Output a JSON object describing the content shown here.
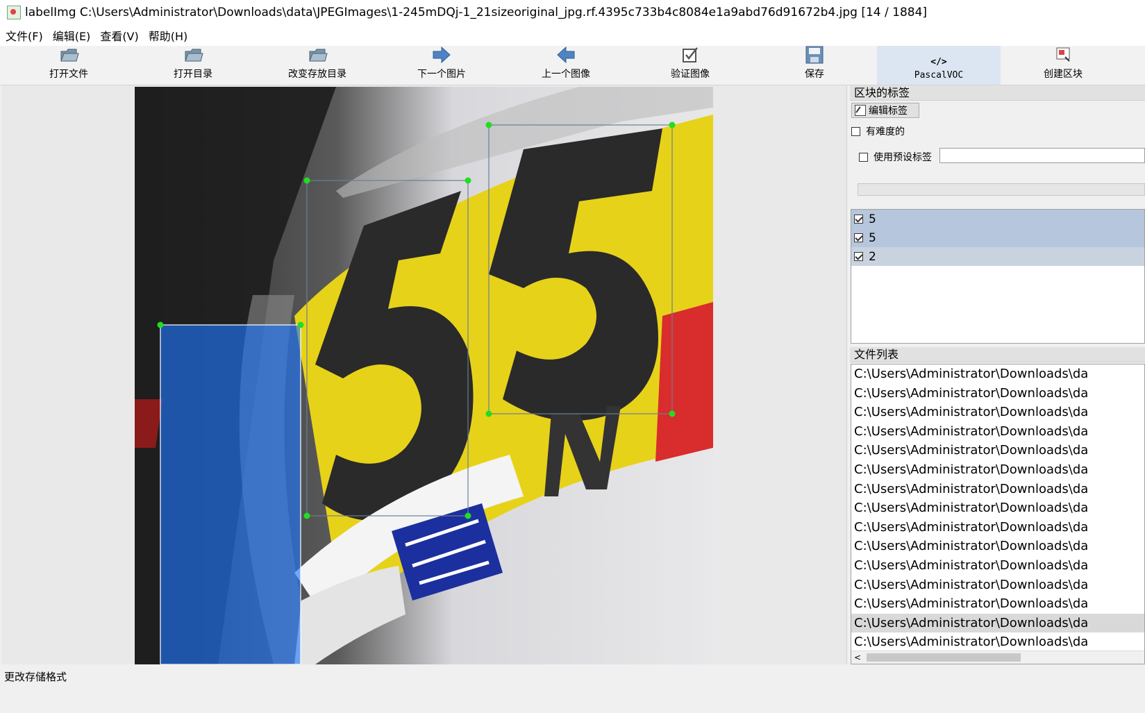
{
  "window": {
    "title": "labelImg C:\\Users\\Administrator\\Downloads\\data\\JPEGImages\\1-245mDQj-1_21sizeoriginal_jpg.rf.4395c733b4c8084e1a9abd76d91672b4.jpg [14 / 1884]"
  },
  "menu": [
    "文件(F)",
    "编辑(E)",
    "查看(V)",
    "帮助(H)"
  ],
  "toolbar": {
    "open_file": "打开文件",
    "open_dir": "打开目录",
    "change_save_dir": "改变存放目录",
    "next_image": "下一个图片",
    "prev_image": "上一个图像",
    "verify_image": "验证图像",
    "save": "保存",
    "format_icon": "</>",
    "format": "PascalVOC",
    "create_box": "创建区块"
  },
  "labels_panel": {
    "title": "区块的标签",
    "edit_label": "编辑标签",
    "difficult": "有难度的",
    "use_default_label": "使用预设标签",
    "default_label_value": "",
    "items": [
      {
        "text": "5",
        "checked": true
      },
      {
        "text": "5",
        "checked": true
      },
      {
        "text": "2",
        "checked": true
      }
    ]
  },
  "file_panel": {
    "title": "文件列表",
    "items": [
      "C:\\Users\\Administrator\\Downloads\\da",
      "C:\\Users\\Administrator\\Downloads\\da",
      "C:\\Users\\Administrator\\Downloads\\da",
      "C:\\Users\\Administrator\\Downloads\\da",
      "C:\\Users\\Administrator\\Downloads\\da",
      "C:\\Users\\Administrator\\Downloads\\da",
      "C:\\Users\\Administrator\\Downloads\\da",
      "C:\\Users\\Administrator\\Downloads\\da",
      "C:\\Users\\Administrator\\Downloads\\da",
      "C:\\Users\\Administrator\\Downloads\\da",
      "C:\\Users\\Administrator\\Downloads\\da",
      "C:\\Users\\Administrator\\Downloads\\da",
      "C:\\Users\\Administrator\\Downloads\\da",
      "C:\\Users\\Administrator\\Downloads\\da",
      "C:\\Users\\Administrator\\Downloads\\da"
    ],
    "selected_index": 13
  },
  "status": "更改存储格式",
  "colors": {
    "accent": "#b6c6dc",
    "box_vertex": "#22dd22",
    "box_line": "#6b7f93",
    "box_fill_selected": "#1e78ff"
  }
}
